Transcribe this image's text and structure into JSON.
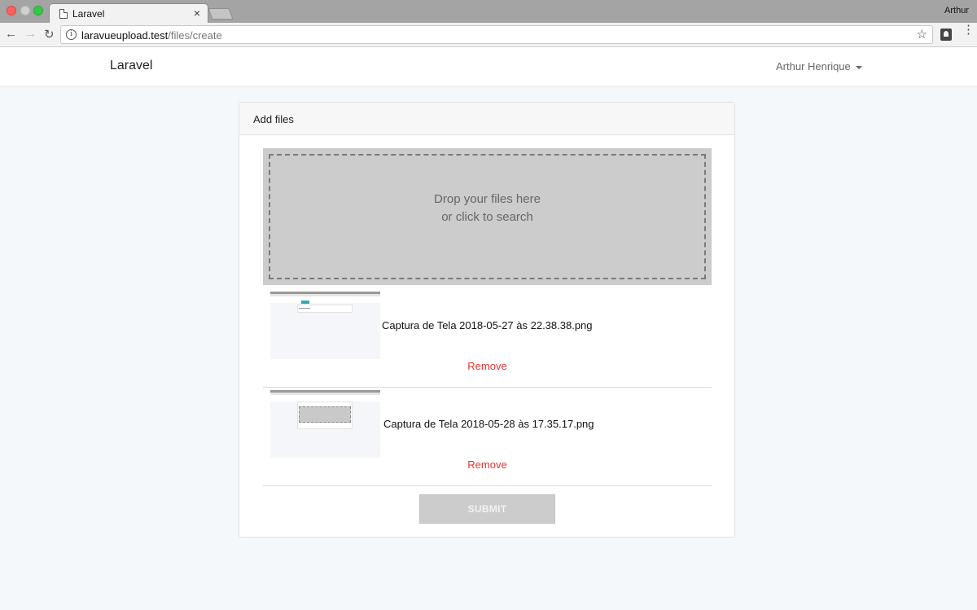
{
  "browser": {
    "tab_title": "Laravel",
    "tab_close": "×",
    "profile_name": "Arthur",
    "url_host": "laravueupload.test",
    "url_path": "/files/create",
    "icons": [
      "back-icon",
      "forward-icon",
      "reload-icon",
      "info-icon",
      "star-icon",
      "extension-icon",
      "menu-icon"
    ]
  },
  "navbar": {
    "brand": "Laravel",
    "user_name": "Arthur Henrique"
  },
  "card": {
    "title": "Add files",
    "dropzone": {
      "line1": "Drop your files here",
      "line2": "or click to search"
    },
    "files": [
      {
        "name": "Captura de Tela 2018-05-27 às 22.38.38.png",
        "remove_label": "Remove"
      },
      {
        "name": "Captura de Tela 2018-05-28 às 17.35.17.png",
        "remove_label": "Remove"
      }
    ],
    "submit_label": "SUBMIT"
  },
  "colors": {
    "remove": "#e3342f",
    "dropzone_bg": "#cccccc",
    "page_bg": "#f5f8fa"
  }
}
